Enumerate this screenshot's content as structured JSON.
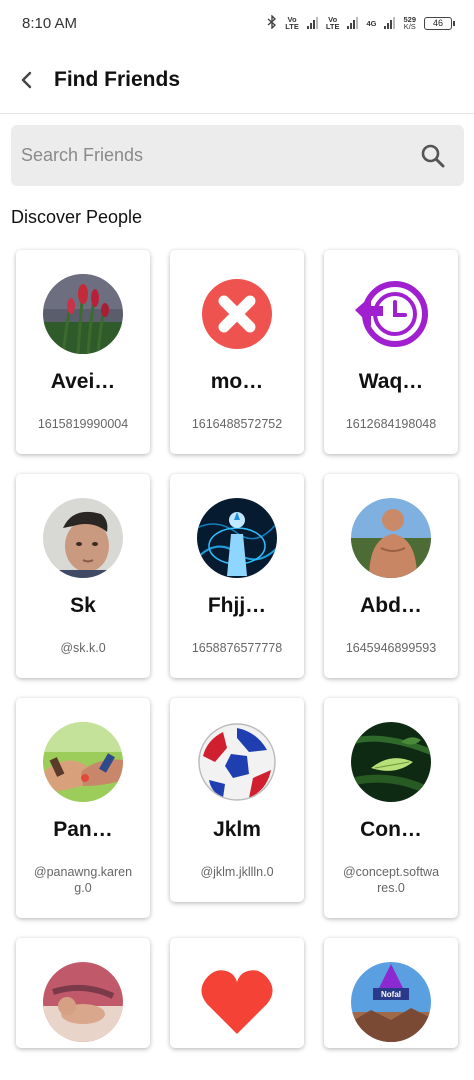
{
  "status_bar": {
    "time": "8:10 AM",
    "net_speed_value": "529",
    "net_speed_unit": "K/S",
    "battery": "46",
    "sim1_label_top": "Vo",
    "sim1_label_bottom": "LTE",
    "sim2_label_top": "Vo",
    "sim2_label_bottom": "LTE",
    "network_type": "4G"
  },
  "header": {
    "title": "Find Friends"
  },
  "search": {
    "placeholder": "Search Friends",
    "value": ""
  },
  "section": {
    "title": "Discover People"
  },
  "people": [
    {
      "name": "Avei…",
      "id": "1615819990004",
      "avatar": "flower-photo"
    },
    {
      "name": "mo…",
      "id": "1616488572752",
      "avatar": "red-x-icon"
    },
    {
      "name": "Waq…",
      "id": "1612684198048",
      "avatar": "purple-clock-icon"
    },
    {
      "name": "Sk",
      "id": "@sk.k.0",
      "avatar": "boy-photo"
    },
    {
      "name": "Fhjj…",
      "id": "1658876577778",
      "avatar": "avatar-glow-photo"
    },
    {
      "name": "Abd…",
      "id": "1645946899593",
      "avatar": "man-photo"
    },
    {
      "name": "Pan…",
      "id": "@panawng.kareng.0",
      "avatar": "hands-photo"
    },
    {
      "name": "Jklm",
      "id": "@jklm.jkllln.0",
      "avatar": "soccer-ball-photo"
    },
    {
      "name": "Con…",
      "id": "@concept.softwares.0",
      "avatar": "leaf-photo"
    },
    {
      "name": "",
      "id": "",
      "avatar": "baby-photo"
    },
    {
      "name": "",
      "id": "",
      "avatar": "red-heart-icon"
    },
    {
      "name": "",
      "id": "",
      "avatar": "nofal-logo",
      "logo_text": "Nofal"
    }
  ],
  "colors": {
    "accent_red": "#ef5350",
    "accent_purple": "#a020d0",
    "search_bg": "#ececec"
  }
}
